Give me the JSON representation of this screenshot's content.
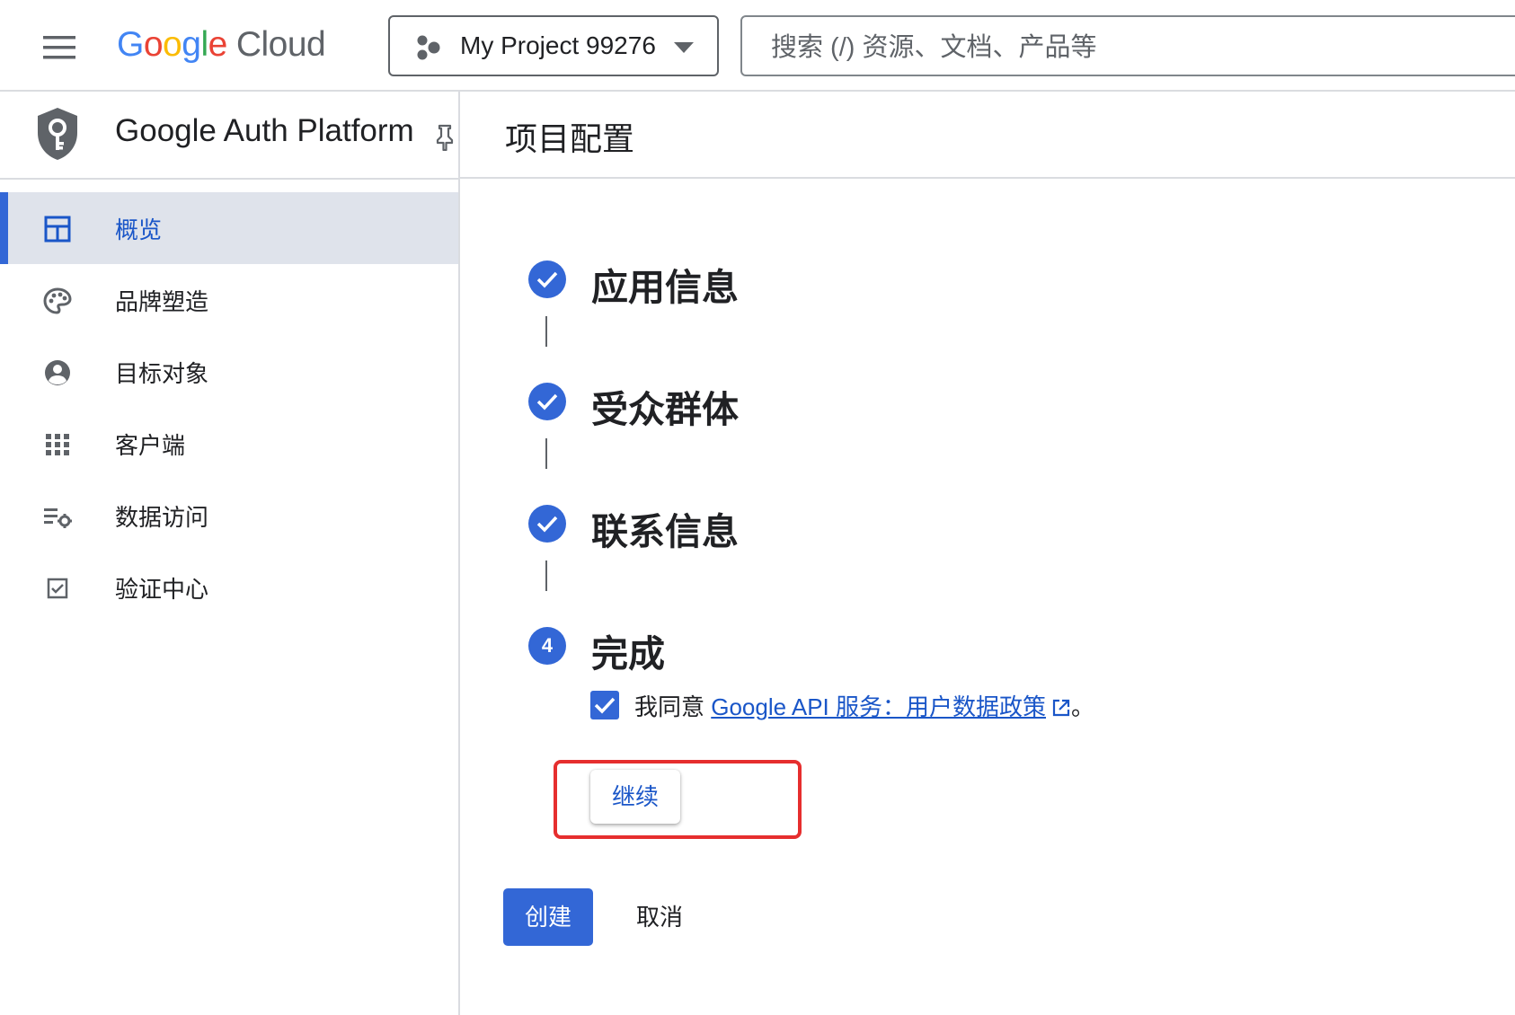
{
  "header": {
    "logo_google_letters": [
      "G",
      "o",
      "o",
      "g",
      "l",
      "e"
    ],
    "logo_google_colors": [
      "#4285F4",
      "#EA4335",
      "#FBBC05",
      "#4285F4",
      "#34A853",
      "#EA4335"
    ],
    "logo_product": "Cloud",
    "project_name": "My Project 99276",
    "search_placeholder": "搜索 (/) 资源、文档、产品等"
  },
  "sidebar": {
    "product_title": "Google Auth Platform",
    "items": [
      {
        "label": "概览",
        "icon": "dashboard-icon",
        "active": true
      },
      {
        "label": "品牌塑造",
        "icon": "palette-icon",
        "active": false
      },
      {
        "label": "目标对象",
        "icon": "account-circle-icon",
        "active": false
      },
      {
        "label": "客户端",
        "icon": "apps-grid-icon",
        "active": false
      },
      {
        "label": "数据访问",
        "icon": "list-settings-icon",
        "active": false
      },
      {
        "label": "验证中心",
        "icon": "check-box-icon",
        "active": false
      }
    ]
  },
  "main": {
    "page_title": "项目配置",
    "steps": [
      {
        "title": "应用信息",
        "status": "completed"
      },
      {
        "title": "受众群体",
        "status": "completed"
      },
      {
        "title": "联系信息",
        "status": "completed"
      },
      {
        "title": "完成",
        "status": "current",
        "number": "4"
      }
    ],
    "agreement": {
      "checked": true,
      "prefix": "我同意 ",
      "link_text": "Google API 服务：用户数据政策",
      "suffix": "。"
    },
    "continue_label": "继续",
    "create_label": "创建",
    "cancel_label": "取消"
  },
  "colors": {
    "accent": "#3367d6",
    "highlight": "#e62e2e"
  }
}
